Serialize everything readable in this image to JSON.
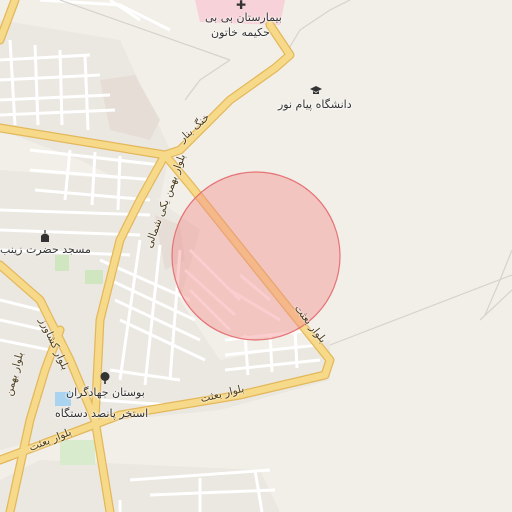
{
  "map": {
    "pois": {
      "hospital_name_line1": "بیمارستان بی بی",
      "hospital_name_line2": "حکیمه خاتون",
      "university": "دانشگاه پیام نور",
      "mosque": "مسجد حضرت زینب",
      "park": "بوستان جهادگران",
      "pool": "استخر پانصد دستگاه"
    },
    "roads": {
      "khang_bar": "خنگ بنار",
      "bahman_north": "بلوار بهمن یکی شمالی",
      "bahman_main": "بلوار بهمن",
      "keshavarz": "بلوار کشاورز",
      "besat_bottom_left": "بلوار بعثت",
      "besat_center": "بلوار بعثت",
      "besat_right": "بلوار بعثت"
    },
    "icons": {
      "hospital": "hospital-cross-icon",
      "university": "graduation-cap-icon",
      "mosque": "mosque-icon",
      "park": "tree-icon"
    },
    "colors": {
      "background": "#f2efe9",
      "major_road": "#f7d98a",
      "major_road_casing": "#e3b85a",
      "minor_road": "#ffffff",
      "highlight_circle": "#f28b8b",
      "hospital_area": "#f7d2d8"
    }
  }
}
